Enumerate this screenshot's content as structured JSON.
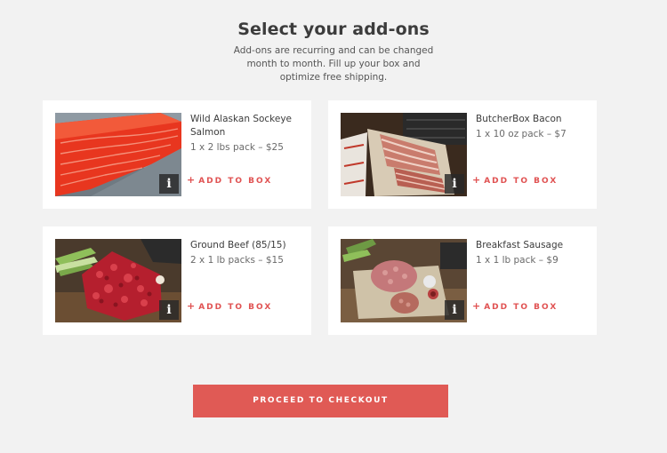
{
  "header": {
    "title": "Select your add-ons",
    "subtitle": "Add-ons are recurring and can be changed month to month. Fill up your box and optimize free shipping."
  },
  "products": [
    {
      "name": "Wild Alaskan Sockeye Salmon",
      "desc": "1 x 2 lbs pack – $25",
      "add_label": "ADD TO BOX",
      "info_label": "i",
      "image_icon": "salmon-fillet"
    },
    {
      "name": "ButcherBox Bacon",
      "desc": "1 x 10 oz pack – $7",
      "add_label": "ADD TO BOX",
      "info_label": "i",
      "image_icon": "bacon-strips"
    },
    {
      "name": "Ground Beef (85/15)",
      "desc": "2 x 1 lb packs – $15",
      "add_label": "ADD TO BOX",
      "info_label": "i",
      "image_icon": "ground-beef"
    },
    {
      "name": "Breakfast Sausage",
      "desc": "1 x 1 lb pack – $9",
      "add_label": "ADD TO BOX",
      "info_label": "i",
      "image_icon": "sausage-patties"
    }
  ],
  "checkout": {
    "label": "PROCEED TO CHECKOUT"
  },
  "colors": {
    "accent": "#e05a55",
    "background": "#f2f2f2",
    "card": "#ffffff"
  }
}
